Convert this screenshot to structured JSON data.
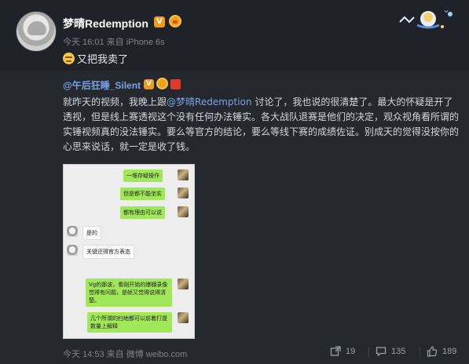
{
  "post": {
    "username": "梦晴Redemption",
    "meta": "今天 16:01 来自 iPhone 6s",
    "text": "又把我卖了"
  },
  "repost": {
    "username": "@午后狂睡_Silent",
    "body_before_mention": "就昨天的视频，我晚上跟",
    "mention": "@梦晴Redemption",
    "body_after_mention": " 讨论了，我也说的很清楚了。最大的怀疑是开了透视，但是线上赛透视这个没有任何办法锤实。各大战队退赛是他们的决定，观众视角看所谓的实锤视频真的没法锤实。要么等官方的结论，要么等线下赛的成绩佐证。别成天的觉得没按你的心思来说话，就一定是收了钱。",
    "meta": "今天 14:53 来自 微博 weibo.com",
    "reposts": "19",
    "comments": "135",
    "likes": "189"
  },
  "chat": {
    "messages": [
      {
        "side": "out",
        "text": "一堆存疑操作"
      },
      {
        "side": "out",
        "text": "但是都不能坐实"
      },
      {
        "side": "out",
        "text": "都有理由可以说"
      },
      {
        "side": "in",
        "text": "是的"
      },
      {
        "side": "in",
        "text": "关键还得官方表态"
      },
      {
        "side": "out",
        "text": "Vg的那波，看刚开始的爆棚录像觉得有问题，是帧又觉得说得清楚。"
      },
      {
        "side": "out",
        "text": "几个所谓的扫地都可以前着打提数量上解释"
      }
    ]
  },
  "icons": {
    "verified": "verified-v-badge",
    "member": "crown-badge",
    "menu": "chevron-down-icon",
    "repost": "repost-icon",
    "comment": "comment-icon",
    "like": "like-icon"
  },
  "colors": {
    "background": "#1d2027",
    "repost_bg": "#25282f",
    "link": "#7ca3e3",
    "badge_orange": "#f29a1a"
  }
}
